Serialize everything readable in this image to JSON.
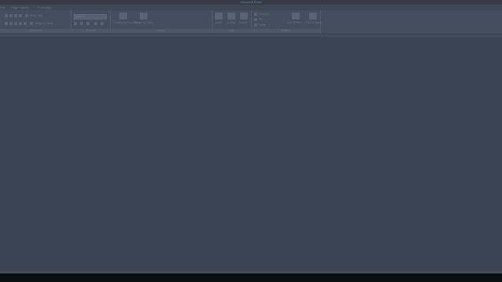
{
  "window": {
    "title": "Microsoft Excel"
  },
  "menubar": {
    "items": [
      "File",
      "Page Layout",
      "Formulas"
    ]
  },
  "ribbon": {
    "groups": [
      {
        "label": "Alignment",
        "text": "Wrap Text",
        "sub": "Merge & Center"
      },
      {
        "label": "Number",
        "text": "General"
      },
      {
        "label": "Styles",
        "items": [
          "Conditional Formatting",
          "Format as Table"
        ]
      },
      {
        "label": "Cells",
        "items": [
          "Insert",
          "Delete",
          "Format"
        ]
      },
      {
        "label": "Editing",
        "items": [
          "AutoSum",
          "Fill",
          "Clear",
          "Sort & Filter",
          "Find & Select"
        ]
      }
    ]
  }
}
